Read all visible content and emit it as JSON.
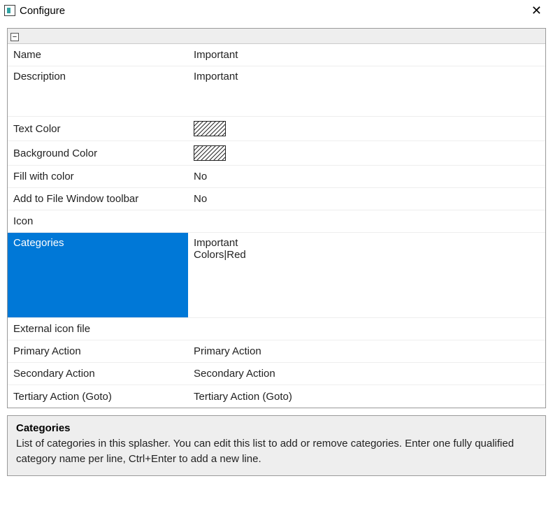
{
  "window": {
    "title": "Configure"
  },
  "prop_rows": [
    {
      "label": "Name",
      "value": "Important",
      "type": "text"
    },
    {
      "label": "Description",
      "value": "Important",
      "type": "text",
      "tall": true,
      "height": 72
    },
    {
      "label": "Text Color",
      "value": "",
      "type": "hatch"
    },
    {
      "label": "Background Color",
      "value": "",
      "type": "hatch"
    },
    {
      "label": "Fill with color",
      "value": "No",
      "type": "text"
    },
    {
      "label": "Add to File Window toolbar",
      "value": "No",
      "type": "text"
    },
    {
      "label": "Icon",
      "value": "",
      "type": "text"
    },
    {
      "label": "Categories",
      "value": "Important\nColors|Red",
      "type": "text",
      "selected": true,
      "tall": true,
      "height": 122
    },
    {
      "label": "External icon file",
      "value": "",
      "type": "text"
    },
    {
      "label": "Primary Action",
      "value": "Primary Action",
      "type": "text"
    },
    {
      "label": "Secondary Action",
      "value": "Secondary Action",
      "type": "text"
    },
    {
      "label": "Tertiary Action (Goto)",
      "value": "Tertiary Action (Goto)",
      "type": "text"
    }
  ],
  "help": {
    "title": "Categories",
    "text": "List of categories in this splasher. You can edit this list to add or remove categories. Enter one fully qualified category name per line, Ctrl+Enter to add a new line."
  }
}
